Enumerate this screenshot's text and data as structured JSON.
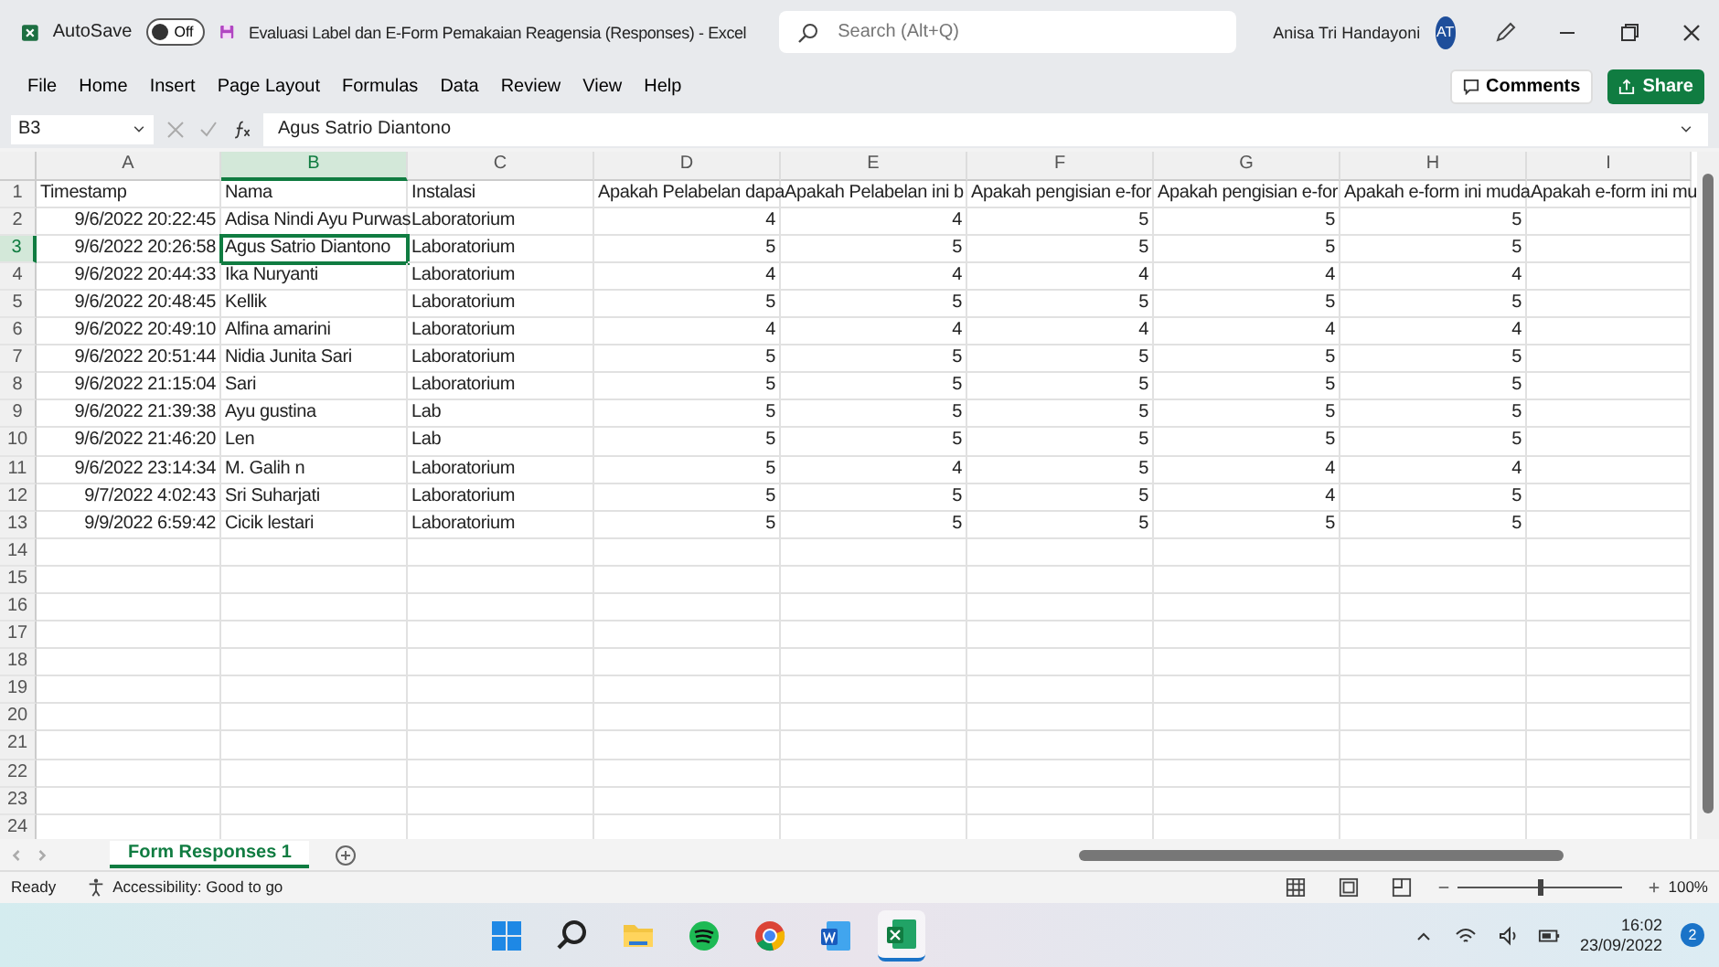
{
  "window": {
    "title": "Evaluasi Label dan E-Form Pemakaian Reagensia (Responses)  -  Excel",
    "autosave_label": "AutoSave",
    "autosave_state": "Off",
    "search_placeholder": "Search (Alt+Q)",
    "user_name": "Anisa Tri Handayoni",
    "user_initials": "AT"
  },
  "ribbon_tabs": [
    {
      "label": "File",
      "selected": false
    },
    {
      "label": "Home",
      "selected": false
    },
    {
      "label": "Insert",
      "selected": false
    },
    {
      "label": "Page Layout",
      "selected": false
    },
    {
      "label": "Formulas",
      "selected": false
    },
    {
      "label": "Data",
      "selected": false
    },
    {
      "label": "Review",
      "selected": false
    },
    {
      "label": "View",
      "selected": false
    },
    {
      "label": "Help",
      "selected": false
    }
  ],
  "ribbon_buttons": {
    "comments": "Comments",
    "share": "Share"
  },
  "formula_bar": {
    "name_box": "B3",
    "formula": "Agus Satrio Diantono"
  },
  "columns": [
    {
      "label": "A",
      "kind": "number",
      "selected": false
    },
    {
      "label": "B",
      "kind": "text",
      "selected": true
    },
    {
      "label": "C",
      "kind": "text",
      "selected": false
    },
    {
      "label": "D",
      "kind": "number",
      "selected": false
    },
    {
      "label": "E",
      "kind": "number",
      "selected": false
    },
    {
      "label": "F",
      "kind": "number",
      "selected": false
    },
    {
      "label": "G",
      "kind": "number",
      "selected": false
    },
    {
      "label": "H",
      "kind": "number",
      "selected": false
    },
    {
      "label": "I",
      "kind": "number",
      "selected": false
    }
  ],
  "rows": [
    {
      "number": "1",
      "kind": "header",
      "selected": false,
      "cells": [
        "Timestamp",
        "Nama",
        "Instalasi",
        "Apakah Pelabelan dapa",
        "Apakah Pelabelan ini b",
        "Apakah pengisian e-for",
        "Apakah pengisian e-for",
        "Apakah e-form ini muda",
        "Apakah e-form ini mu"
      ]
    },
    {
      "number": "2",
      "kind": "data",
      "selected": false,
      "cells": [
        "9/6/2022 20:22:45",
        "Adisa Nindi Ayu Purwas",
        "Laboratorium",
        "4",
        "4",
        "5",
        "5",
        "5"
      ]
    },
    {
      "number": "3",
      "kind": "data",
      "selected": true,
      "cells": [
        "9/6/2022 20:26:58",
        "Agus Satrio Diantono",
        "Laboratorium",
        "5",
        "5",
        "5",
        "5",
        "5"
      ]
    },
    {
      "number": "4",
      "kind": "data",
      "selected": false,
      "cells": [
        "9/6/2022 20:44:33",
        "Ika Nuryanti",
        "Laboratorium",
        "4",
        "4",
        "4",
        "4",
        "4"
      ]
    },
    {
      "number": "5",
      "kind": "data",
      "selected": false,
      "cells": [
        "9/6/2022 20:48:45",
        "Kellik",
        "Laboratorium",
        "5",
        "5",
        "5",
        "5",
        "5"
      ]
    },
    {
      "number": "6",
      "kind": "data",
      "selected": false,
      "cells": [
        "9/6/2022 20:49:10",
        "Alfina amarini",
        "Laboratorium",
        "4",
        "4",
        "4",
        "4",
        "4"
      ]
    },
    {
      "number": "7",
      "kind": "data",
      "selected": false,
      "cells": [
        "9/6/2022 20:51:44",
        "Nidia Junita Sari",
        "Laboratorium",
        "5",
        "5",
        "5",
        "5",
        "5"
      ]
    },
    {
      "number": "8",
      "kind": "data",
      "selected": false,
      "cells": [
        "9/6/2022 21:15:04",
        "Sari",
        "Laboratorium",
        "5",
        "5",
        "5",
        "5",
        "5"
      ]
    },
    {
      "number": "9",
      "kind": "data",
      "selected": false,
      "cells": [
        "9/6/2022 21:39:38",
        "Ayu gustina",
        "Lab",
        "5",
        "5",
        "5",
        "5",
        "5"
      ]
    },
    {
      "number": "10",
      "kind": "data",
      "selected": false,
      "cells": [
        "9/6/2022 21:46:20",
        "Len",
        "Lab",
        "5",
        "5",
        "5",
        "5",
        "5"
      ]
    },
    {
      "number": "11",
      "kind": "data",
      "selected": false,
      "cells": [
        "9/6/2022 23:14:34",
        "M. Galih n",
        "Laboratorium",
        "5",
        "4",
        "5",
        "4",
        "4"
      ]
    },
    {
      "number": "12",
      "kind": "data",
      "selected": false,
      "cells": [
        "9/7/2022 4:02:43",
        "Sri  Suharjati",
        "Laboratorium",
        "5",
        "5",
        "5",
        "4",
        "5"
      ]
    },
    {
      "number": "13",
      "kind": "data",
      "selected": false,
      "cells": [
        "9/9/2022 6:59:42",
        "Cicik lestari",
        "Laboratorium",
        "5",
        "5",
        "5",
        "5",
        "5"
      ]
    },
    {
      "number": "14",
      "kind": "data",
      "selected": false,
      "cells": []
    },
    {
      "number": "15",
      "kind": "data",
      "selected": false,
      "cells": []
    },
    {
      "number": "16",
      "kind": "data",
      "selected": false,
      "cells": []
    },
    {
      "number": "17",
      "kind": "data",
      "selected": false,
      "cells": []
    },
    {
      "number": "18",
      "kind": "data",
      "selected": false,
      "cells": []
    },
    {
      "number": "19",
      "kind": "data",
      "selected": false,
      "cells": []
    },
    {
      "number": "20",
      "kind": "data",
      "selected": false,
      "cells": []
    },
    {
      "number": "21",
      "kind": "data",
      "selected": false,
      "cells": []
    },
    {
      "number": "22",
      "kind": "data",
      "selected": false,
      "cells": []
    },
    {
      "number": "23",
      "kind": "data",
      "selected": false,
      "cells": []
    },
    {
      "number": "24",
      "kind": "data",
      "selected": false,
      "cells": []
    }
  ],
  "sheet_tabs": [
    {
      "label": "Form Responses 1",
      "selected": true
    }
  ],
  "status_bar": {
    "mode": "Ready",
    "accessibility": "Accessibility: Good to go",
    "zoom": "100%",
    "zoom_slider": {
      "level": 0.5
    }
  },
  "taskbar": {
    "time": "16:02",
    "date": "23/09/2022",
    "notifications": "2"
  }
}
